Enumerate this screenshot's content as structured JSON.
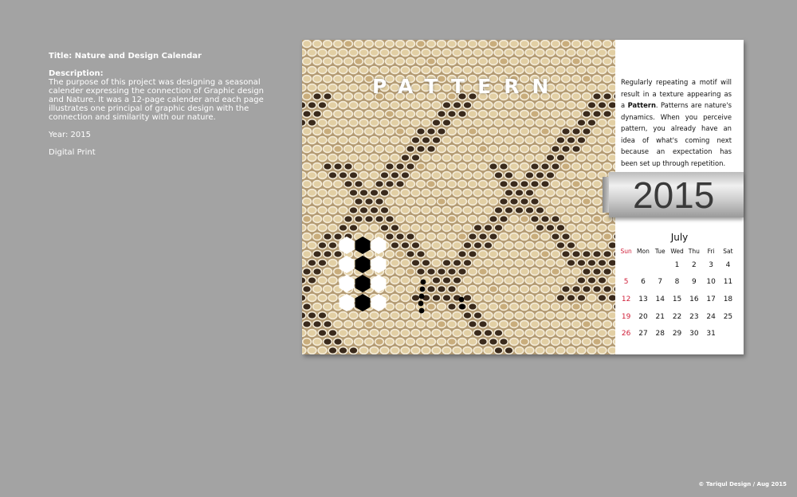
{
  "info": {
    "title_label": "Title: Nature and Design Calendar",
    "description_label": "Description:",
    "description_text": "The purpose of this project was designing a seasonal calender expressing the connection of Graphic design and Nature. It was a 12-page calender and each page illustrates one principal of graphic design with the connection and similarity with our nature.",
    "year_label": "Year: 2015",
    "medium": "Digital Print"
  },
  "calendar": {
    "photo_title": "PATTERN",
    "blurb_part1": "Regularly repeating a motif will result in a texture appearing as a ",
    "blurb_bold": "Pattern",
    "blurb_part2": ". Patterns are nature's dynamics. When you perceive pattern, you already have an idea of what's coming next because an expectation has been set up through repetition.",
    "year": "2015",
    "month": "July",
    "weekdays": [
      "Sun",
      "Mon",
      "Tue",
      "Wed",
      "Thu",
      "Fri",
      "Sat"
    ],
    "weeks": [
      [
        "",
        "",
        "",
        "1",
        "2",
        "3",
        "4"
      ],
      [
        "5",
        "6",
        "7",
        "8",
        "9",
        "10",
        "11"
      ],
      [
        "12",
        "13",
        "14",
        "15",
        "16",
        "17",
        "18"
      ],
      [
        "19",
        "20",
        "21",
        "22",
        "23",
        "24",
        "25"
      ],
      [
        "26",
        "27",
        "28",
        "29",
        "30",
        "31",
        ""
      ]
    ]
  },
  "colors": {
    "background": "#a3a3a3",
    "sunday": "#d0203a",
    "scale_light": "#e2cfa4",
    "scale_dark": "#3a2a1c"
  },
  "footer": "© Tariqul Design / Aug 2015"
}
